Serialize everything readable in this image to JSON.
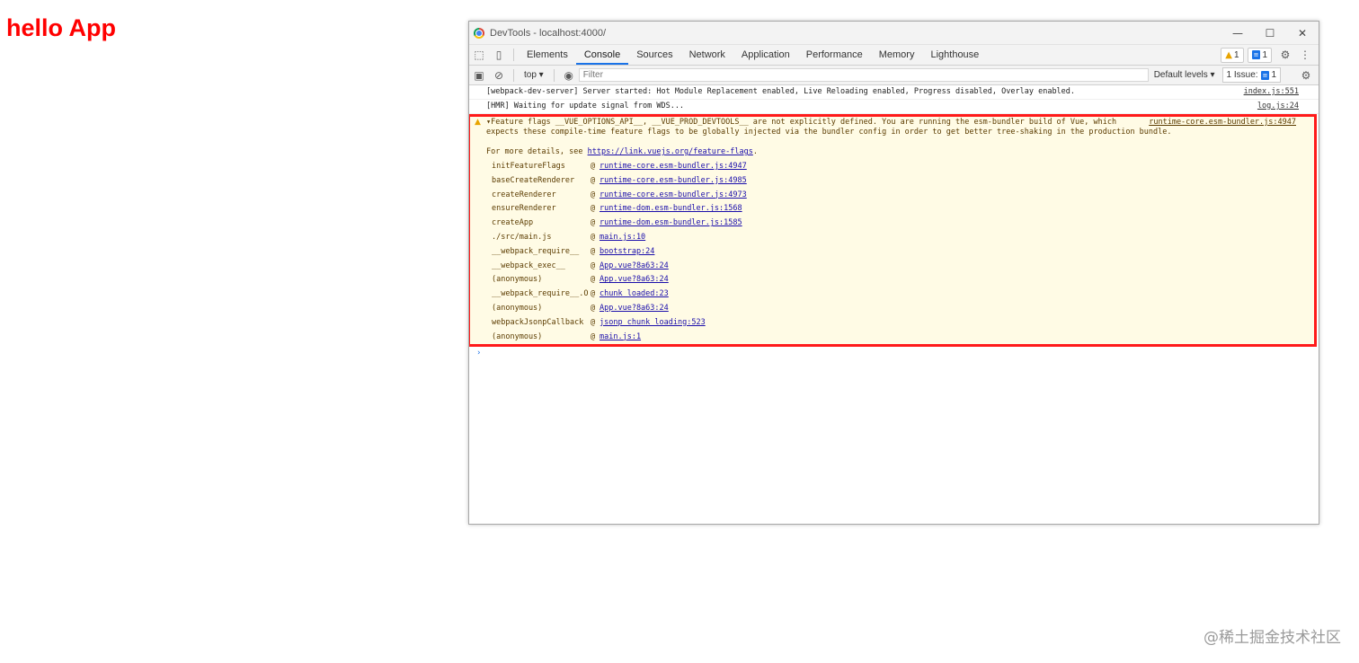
{
  "page": {
    "heading": "hello App",
    "watermark": "@稀土掘金技术社区"
  },
  "window": {
    "title": "DevTools - localhost:4000/",
    "controls": {
      "minimize": "—",
      "maximize": "☐",
      "close": "✕"
    }
  },
  "tabs": {
    "items": [
      "Elements",
      "Console",
      "Sources",
      "Network",
      "Application",
      "Performance",
      "Memory",
      "Lighthouse"
    ],
    "active": "Console",
    "warnings_count": "1",
    "messages_count": "1"
  },
  "toolbar": {
    "context": "top ▾",
    "filter_placeholder": "Filter",
    "levels": "Default levels ▾",
    "issues_label": "1 Issue:",
    "issues_count": "1"
  },
  "logs": [
    {
      "text": "[webpack-dev-server] Server started: Hot Module Replacement enabled, Live Reloading enabled, Progress disabled, Overlay enabled.",
      "source": "index.js:551"
    },
    {
      "text": "[HMR] Waiting for update signal from WDS...",
      "source": "log.js:24"
    }
  ],
  "warning": {
    "line1": "▾Feature flags __VUE_OPTIONS_API__, __VUE_PROD_DEVTOOLS__ are not explicitly defined. You are running the esm-bundler build of Vue, which",
    "line2": "expects these compile-time feature flags to be globally injected via the bundler config in order to get better tree-shaking in the production bundle.",
    "source": "runtime-core.esm-bundler.js:4947",
    "details_prefix": "For more details, see ",
    "details_link": "https://link.vuejs.org/feature-flags",
    "details_suffix": ".",
    "stack": [
      {
        "fn": "initFeatureFlags",
        "loc": "runtime-core.esm-bundler.js:4947"
      },
      {
        "fn": "baseCreateRenderer",
        "loc": "runtime-core.esm-bundler.js:4985"
      },
      {
        "fn": "createRenderer",
        "loc": "runtime-core.esm-bundler.js:4973"
      },
      {
        "fn": "ensureRenderer",
        "loc": "runtime-dom.esm-bundler.js:1568"
      },
      {
        "fn": "createApp",
        "loc": "runtime-dom.esm-bundler.js:1585"
      },
      {
        "fn": "./src/main.js",
        "loc": "main.js:10"
      },
      {
        "fn": "__webpack_require__",
        "loc": "bootstrap:24"
      },
      {
        "fn": "__webpack_exec__",
        "loc": "App.vue?8a63:24"
      },
      {
        "fn": "(anonymous)",
        "loc": "App.vue?8a63:24"
      },
      {
        "fn": "__webpack_require__.O",
        "loc": "chunk loaded:23"
      },
      {
        "fn": "(anonymous)",
        "loc": "App.vue?8a63:24"
      },
      {
        "fn": "webpackJsonpCallback",
        "loc": "jsonp chunk loading:523"
      },
      {
        "fn": "(anonymous)",
        "loc": "main.js:1"
      }
    ]
  },
  "prompt": "›",
  "colors": {
    "heading": "#ff0000",
    "highlight_border": "#ff1a1a",
    "warning_bg": "#fffbe5",
    "accent": "#1a73e8"
  }
}
